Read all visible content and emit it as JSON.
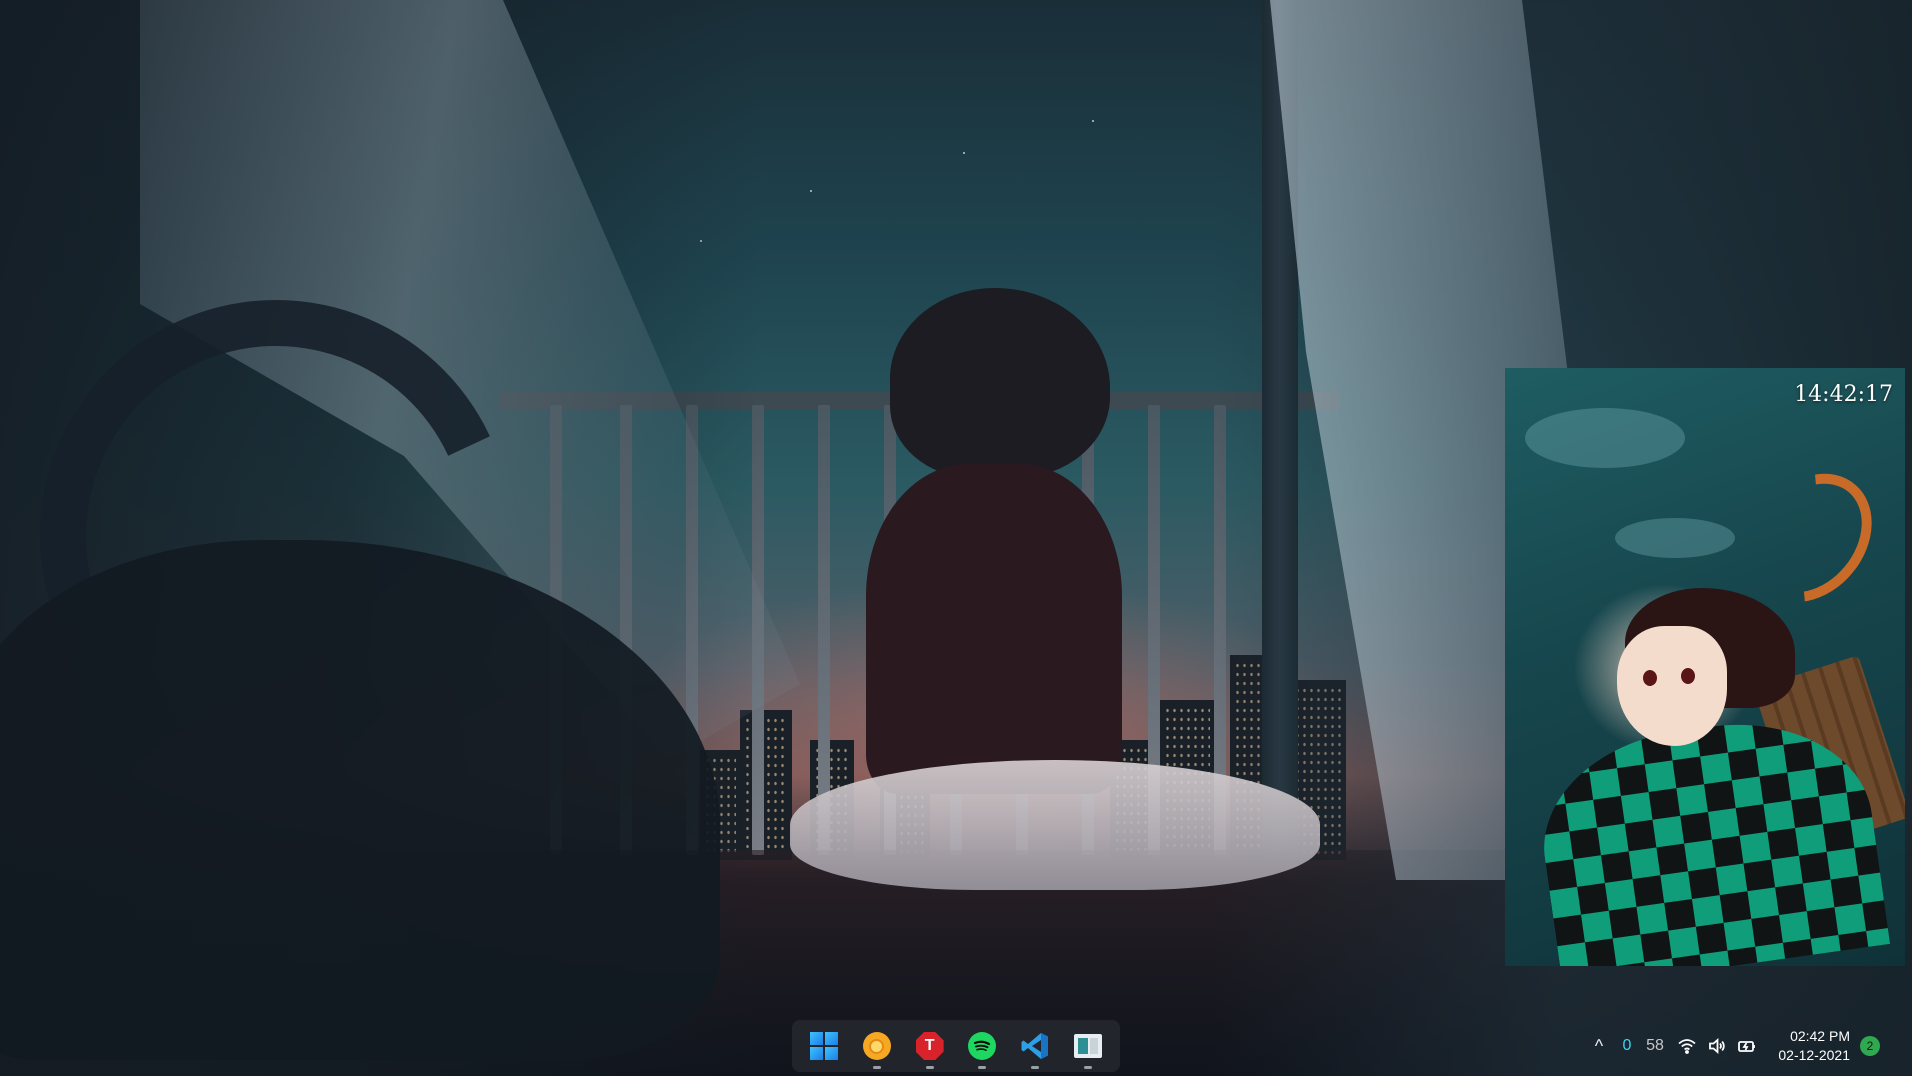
{
  "wallpaper": {
    "palette": [
      "#1f4550",
      "#7a5a5a",
      "#141820"
    ]
  },
  "widget": {
    "clock": "14:42:17"
  },
  "taskbar": {
    "accent": "#3fc3ff",
    "apps": [
      {
        "name": "Start",
        "icon": "windows-logo-icon"
      },
      {
        "name": "Chrome Canary",
        "icon": "chrome-icon"
      },
      {
        "name": "T",
        "icon": "stop-sign-app-icon",
        "label": "T"
      },
      {
        "name": "Spotify",
        "icon": "spotify-icon"
      },
      {
        "name": "Visual Studio Code",
        "icon": "vscode-icon"
      },
      {
        "name": "File Explorer",
        "icon": "explorer-icon"
      }
    ]
  },
  "tray": {
    "chevron": "^",
    "net_up": "0",
    "net_down": "58",
    "time": "02:42 PM",
    "date": "02-12-2021",
    "notifications": "2",
    "notification_color": "#2fa84f"
  }
}
